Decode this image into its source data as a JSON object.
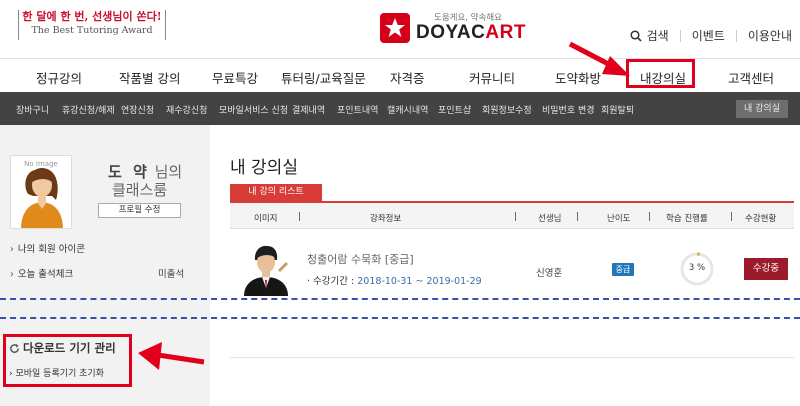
{
  "header": {
    "promo_line1": "한 달에 한 번, 선생님이 쏜다!",
    "promo_line2": "The Best Tutoring Award",
    "logo_tagline": "도움게요, 약속해요",
    "logo_word1": "DOYAC",
    "logo_word2": "ART",
    "util": {
      "search": "검색",
      "event": "이벤트",
      "guide": "이용안내"
    }
  },
  "main_nav": [
    "정규강의",
    "작품별 강의",
    "무료특강",
    "튜터링/교육질문",
    "자격증",
    "커뮤니티",
    "도약화방",
    "내강의실",
    "고객센터"
  ],
  "sub_nav": [
    "장바구니",
    "휴강신청/해제",
    "연장신청",
    "재수강신청",
    "모바일서비스 신청",
    "결제내역",
    "포인트내역",
    "캘캐시내역",
    "포인트샵",
    "회원정보수정",
    "비밀번호 변경",
    "회원탈퇴"
  ],
  "sub_nav_button": "내 강의실",
  "profile": {
    "no_image": "No Image",
    "name": "도 약",
    "suffix": "님의",
    "room": "클래스룸",
    "edit_button": "프로필 수정",
    "icon_link": "나의 회원 아이콘",
    "attendance_link": "오늘 출석체크",
    "attendance_status": "미출석",
    "download_title": "다운로드 기기 관리",
    "download_sub": "모바일 등록기기 초기화"
  },
  "content": {
    "page_title": "내 강의실",
    "tab_label": "내 강의 리스트",
    "columns": [
      "이미지",
      "강좌정보",
      "선생님",
      "난이도",
      "학습 진행률",
      "수강현황"
    ],
    "course": {
      "title": "청출어람 수묵화 [중급]",
      "period_label": "· 수강기간 :",
      "period_dates": "2018-10-31 ~ 2019-01-29",
      "teacher": "신영훈",
      "level": "중급",
      "progress_text": "3 %",
      "progress": 0.03,
      "status": "수강중"
    }
  },
  "colors": {
    "brand_red": "#d4001a",
    "annotation_red": "#e0001b",
    "level_blue": "#2178b8",
    "status_maroon": "#9b1b2a",
    "dashed_blue": "#3b4ea8"
  }
}
